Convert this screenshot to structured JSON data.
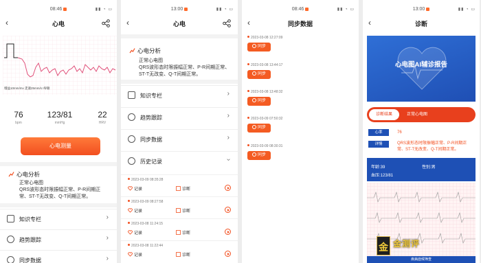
{
  "status": {
    "p1_time": "08:46",
    "p2_time": "13:00",
    "p3_time": "08:46",
    "p4_time": "13:00"
  },
  "screen1": {
    "title": "心电",
    "ecg_caption": "增益10mm/mv 走速25mm/s I导联",
    "stats": [
      {
        "value": "76",
        "unit": "bpm"
      },
      {
        "value": "123/81",
        "unit": "mmHg"
      },
      {
        "value": "22",
        "unit": "HRV"
      }
    ],
    "measure_button": "心电测量",
    "analysis": {
      "title": "心电分析",
      "lines": [
        "正常心电图",
        "QRS波形态时限振幅正常、P-R间期正常、ST-T无改变、Q-T间期正常。"
      ]
    },
    "menu": [
      {
        "label": "知识专栏"
      },
      {
        "label": "趋势跟踪"
      },
      {
        "label": "同步数据"
      }
    ]
  },
  "screen2": {
    "title": "心电",
    "analysis": {
      "title": "心电分析",
      "lines": [
        "正常心电图",
        "QRS波形态时限振幅正常、P-R间期正常、ST-T无改变、Q-T间期正常。"
      ]
    },
    "menu": [
      {
        "label": "知识专栏"
      },
      {
        "label": "趋势跟踪"
      },
      {
        "label": "同步数据"
      },
      {
        "label": "历史记录"
      }
    ],
    "records": [
      {
        "time": "2023-03-09 08:35:28",
        "record": "记录",
        "diagnose": "诊断"
      },
      {
        "time": "2023-03-09 08:27:58",
        "record": "记录",
        "diagnose": "诊断"
      },
      {
        "time": "2023-03-08 11:24:15",
        "record": "记录",
        "diagnose": "诊断"
      },
      {
        "time": "2023-03-08 11:22:44",
        "record": "记录",
        "diagnose": "诊断"
      }
    ]
  },
  "screen3": {
    "title": "同步数据",
    "items": [
      {
        "time": "2023-03-08 12:27:09",
        "button": "同步"
      },
      {
        "time": "2023-03-08 13:44:17",
        "button": "同步"
      },
      {
        "time": "2023-03-08 13:48:32",
        "button": "同步"
      },
      {
        "time": "2023-03-09 07:50:32",
        "button": "同步"
      },
      {
        "time": "2023-03-09 08:30:31",
        "button": "同步"
      }
    ]
  },
  "screen4": {
    "title": "诊断",
    "hero_title": "心电图AI辅诊报告",
    "tabs": {
      "active": "诊断结果",
      "result": "正常心电图"
    },
    "heart_rate_label": "心率",
    "heart_rate_value": "76",
    "detail_label": "详情",
    "detail_value": "QRS波形态时限振幅正常、P-R间期正常、ST-T无改变、Q-T间期正常。",
    "age": "年龄:39",
    "gender": "性别:男",
    "bp": "血压:123/81",
    "footer": "疾病症候筛查"
  },
  "watermark": {
    "badge": "金",
    "name": "金测评",
    "url": "jincepin.com"
  },
  "colors": {
    "accent": "#f24f1f",
    "blue": "#1e50b5",
    "ecg": "#e0507a"
  }
}
